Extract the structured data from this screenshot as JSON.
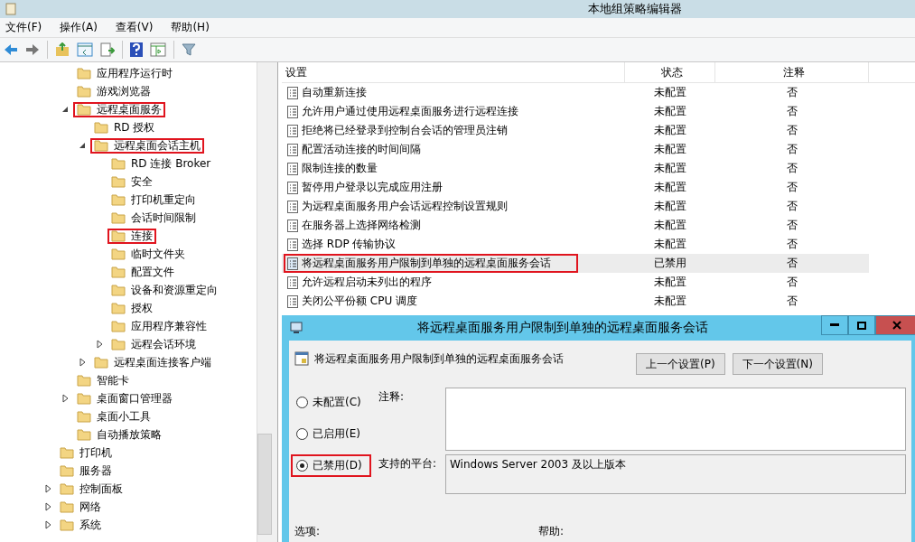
{
  "window": {
    "title": "本地组策略编辑器"
  },
  "menu": [
    "文件(F)",
    "操作(A)",
    "查看(V)",
    "帮助(H)"
  ],
  "tree": {
    "items": [
      {
        "children": [
          {
            "label": "应用程序运行时"
          },
          {
            "label": "游戏浏览器"
          },
          {
            "label": "远程桌面服务",
            "expanded": true,
            "highlighted": true,
            "children": [
              {
                "label": "RD 授权"
              },
              {
                "label": "远程桌面会话主机",
                "expanded": true,
                "highlighted": true,
                "children": [
                  {
                    "label": "RD 连接 Broker"
                  },
                  {
                    "label": "安全"
                  },
                  {
                    "label": "打印机重定向"
                  },
                  {
                    "label": "会话时间限制"
                  },
                  {
                    "label": "连接",
                    "highlighted": true
                  },
                  {
                    "label": "临时文件夹"
                  },
                  {
                    "label": "配置文件"
                  },
                  {
                    "label": "设备和资源重定向"
                  },
                  {
                    "label": "授权"
                  },
                  {
                    "label": "应用程序兼容性"
                  },
                  {
                    "label": "远程会话环境",
                    "expanded": false
                  }
                ]
              },
              {
                "label": "远程桌面连接客户端",
                "expanded": false
              }
            ]
          },
          {
            "label": "智能卡"
          },
          {
            "label": "桌面窗口管理器",
            "expanded": false
          },
          {
            "label": "桌面小工具"
          },
          {
            "label": "自动播放策略"
          }
        ]
      },
      {
        "label": "打印机"
      },
      {
        "label": "服务器"
      },
      {
        "label": "控制面板",
        "expanded": false
      },
      {
        "label": "网络",
        "expanded": false
      },
      {
        "label": "系统",
        "expanded": false
      }
    ]
  },
  "table": {
    "columns": [
      "设置",
      "状态",
      "注释"
    ],
    "rows": [
      {
        "setting": "自动重新连接",
        "state": "未配置",
        "comment": "否",
        "selected": false
      },
      {
        "setting": "允许用户通过使用远程桌面服务进行远程连接",
        "state": "未配置",
        "comment": "否",
        "selected": false
      },
      {
        "setting": "拒绝将已经登录到控制台会话的管理员注销",
        "state": "未配置",
        "comment": "否",
        "selected": false
      },
      {
        "setting": "配置活动连接的时间间隔",
        "state": "未配置",
        "comment": "否",
        "selected": false
      },
      {
        "setting": "限制连接的数量",
        "state": "未配置",
        "comment": "否",
        "selected": false
      },
      {
        "setting": "暂停用户登录以完成应用注册",
        "state": "未配置",
        "comment": "否",
        "selected": false
      },
      {
        "setting": "为远程桌面服务用户会话远程控制设置规则",
        "state": "未配置",
        "comment": "否",
        "selected": false
      },
      {
        "setting": "在服务器上选择网络检测",
        "state": "未配置",
        "comment": "否",
        "selected": false
      },
      {
        "setting": "选择 RDP 传输协议",
        "state": "未配置",
        "comment": "否",
        "selected": false
      },
      {
        "setting": "将远程桌面服务用户限制到单独的远程桌面服务会话",
        "state": "已禁用",
        "comment": "否",
        "selected": true
      },
      {
        "setting": "允许远程启动未列出的程序",
        "state": "未配置",
        "comment": "否",
        "selected": false
      },
      {
        "setting": "关闭公平份额 CPU 调度",
        "state": "未配置",
        "comment": "否",
        "selected": false
      }
    ]
  },
  "dialog": {
    "title": "将远程桌面服务用户限制到单独的远程桌面服务会话",
    "heading": "将远程桌面服务用户限制到单独的远程桌面服务会话",
    "buttons": [
      "上一个设置(P)",
      "下一个设置(N)"
    ],
    "options": [
      {
        "label": "未配置(C)",
        "selected": false
      },
      {
        "label": "已启用(E)",
        "selected": false
      },
      {
        "label": "已禁用(D)",
        "selected": true
      }
    ],
    "comment_label": "注释:",
    "platform_label": "支持的平台:",
    "platform_value": "Windows Server 2003 及以上版本",
    "options_label": "选项:",
    "help_label": "帮助:"
  }
}
